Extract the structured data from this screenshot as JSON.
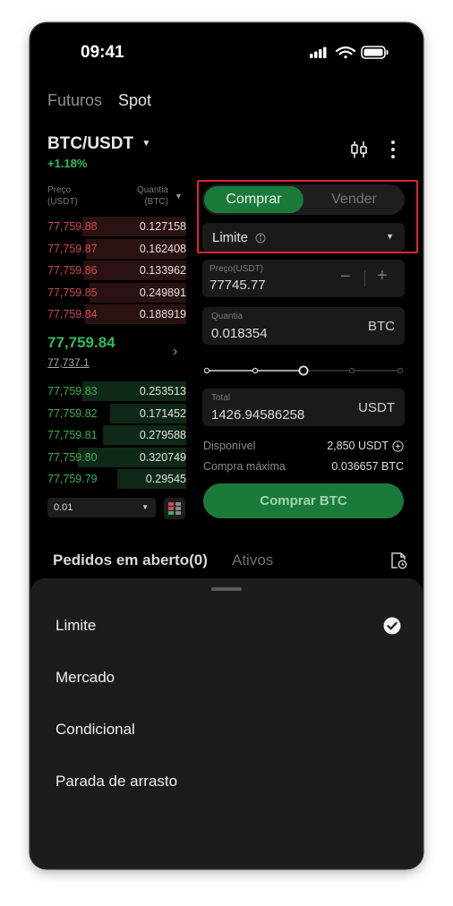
{
  "status_bar": {
    "time": "09:41"
  },
  "nav": {
    "futures": "Futuros",
    "spot": "Spot"
  },
  "pair": {
    "symbol": "BTC/USDT",
    "change": "+1.18%"
  },
  "orderbook": {
    "price_header_1": "Preço",
    "price_header_2": "(USDT)",
    "qty_header_1": "Quantia",
    "qty_header_2": "(BTC)",
    "asks": [
      {
        "price": "77,759.88",
        "qty": "0.127158",
        "depth": 0.75
      },
      {
        "price": "77,759.87",
        "qty": "0.162408",
        "depth": 0.72
      },
      {
        "price": "77,759.86",
        "qty": "0.133962",
        "depth": 0.74
      },
      {
        "price": "77,759.85",
        "qty": "0.249891",
        "depth": 0.7
      },
      {
        "price": "77,759.84",
        "qty": "0.188919",
        "depth": 0.73
      }
    ],
    "last_price": "77,759.84",
    "mark_price": "77,737.1",
    "bids": [
      {
        "price": "77,759.83",
        "qty": "0.253513",
        "depth": 0.75
      },
      {
        "price": "77,759.82",
        "qty": "0.171452",
        "depth": 0.55
      },
      {
        "price": "77,759.81",
        "qty": "0.279588",
        "depth": 0.6
      },
      {
        "price": "77,759.80",
        "qty": "0.320749",
        "depth": 0.78
      },
      {
        "price": "77,759.79",
        "qty": "0.29545",
        "depth": 0.5
      }
    ],
    "depth_value": "0.01"
  },
  "trade": {
    "buy_tab": "Comprar",
    "sell_tab": "Vender",
    "order_type": "Limite",
    "price_label": "Preço(USDT)",
    "price_value": "77745.77",
    "qty_label": "Quantia",
    "qty_value": "0.018354",
    "qty_unit": "BTC",
    "slider_fraction": 0.5,
    "total_label": "Total",
    "total_value": "1426.94586258",
    "total_unit": "USDT",
    "available_label": "Disponível",
    "available_value": "2,850 USDT",
    "max_buy_label": "Compra máxima",
    "max_buy_value": "0.036657 BTC",
    "submit": "Comprar BTC"
  },
  "orders": {
    "open_tab": "Pedidos em aberto(0)",
    "assets_tab": "Ativos"
  },
  "sheet": {
    "options": [
      {
        "label": "Limite",
        "selected": true
      },
      {
        "label": "Mercado",
        "selected": false
      },
      {
        "label": "Condicional",
        "selected": false
      },
      {
        "label": "Parada de arrasto",
        "selected": false
      }
    ]
  },
  "colors": {
    "green": "#2fbd5b",
    "buy_bg": "#1a7a3a",
    "red": "#d14a4a",
    "highlight": "#e0242e"
  }
}
